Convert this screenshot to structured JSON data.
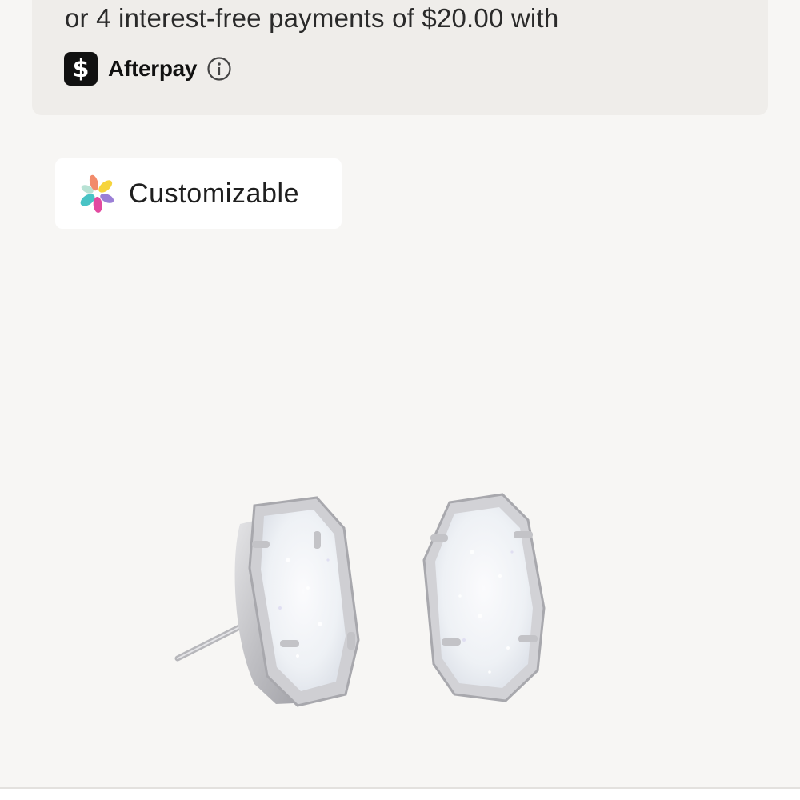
{
  "afterpay": {
    "installment_text": "or 4 interest-free payments of $20.00 with",
    "cashapp_glyph": "$",
    "brand_name": "Afterpay",
    "info_icon": "info-circle-icon"
  },
  "badge": {
    "icon": "kaleidoscope-petals-icon",
    "label": "Customizable"
  },
  "product_image": {
    "subject": "earrings-image"
  },
  "colors": {
    "page_bg": "#f7f6f4",
    "afterpay_bg": "#efedea",
    "badge_bg": "#ffffff",
    "text": "#1f1f1f"
  }
}
